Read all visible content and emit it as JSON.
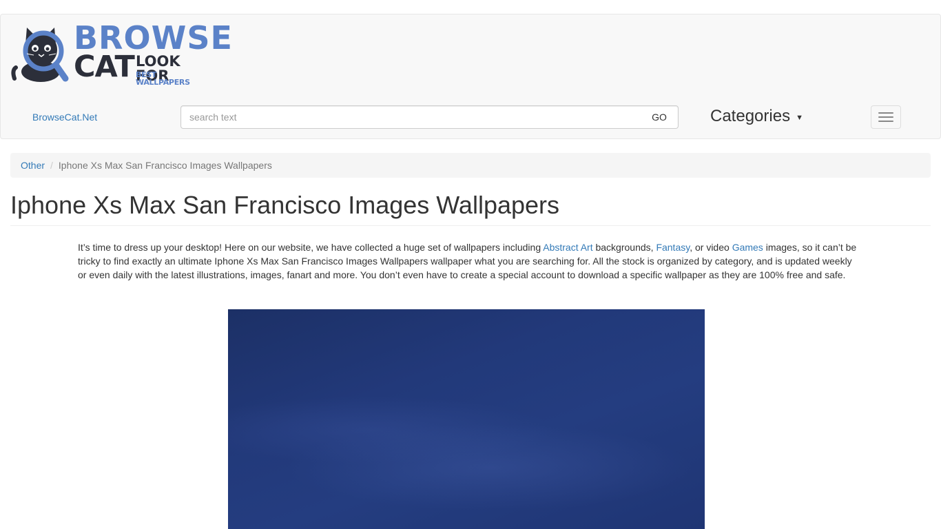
{
  "logo": {
    "line1": "BROWSE",
    "line2": "CAT",
    "line3": "LOOK FOR",
    "line4": "BEST WALLPAPERS"
  },
  "nav": {
    "brand_link": "BrowseCat.Net",
    "search_placeholder": "search text",
    "go_label": "GO",
    "categories_label": "Categories",
    "caret_icon": "caret-down-icon",
    "toggle_icon": "hamburger-menu-icon"
  },
  "breadcrumb": {
    "items": [
      "Other",
      "Iphone Xs Max San Francisco Images Wallpapers"
    ],
    "separator": "/"
  },
  "page": {
    "title": "Iphone Xs Max San Francisco Images Wallpapers",
    "intro": {
      "part1": "It’s time to dress up your desktop! Here on our website, we have collected a huge set of wallpapers including ",
      "link1": "Abstract Art",
      "part2": " backgrounds, ",
      "link2": "Fantasy",
      "part3": ", or video ",
      "link3": "Games",
      "part4": " images, so it can’t be tricky to find exactly an ultimate Iphone Xs Max San Francisco Images Wallpapers wallpaper what you are searching for. All the stock is organized by category, and is updated weekly or even daily with the latest illustrations, images, fanart and more. You don’t even have to create a special account to download a specific wallpaper as they are 100% free and safe."
    }
  },
  "colors": {
    "link": "#337ab7",
    "logo_blue": "#5b82c8",
    "logo_dark": "#2c2f3a",
    "wallpaper_blue": "#22397a"
  }
}
